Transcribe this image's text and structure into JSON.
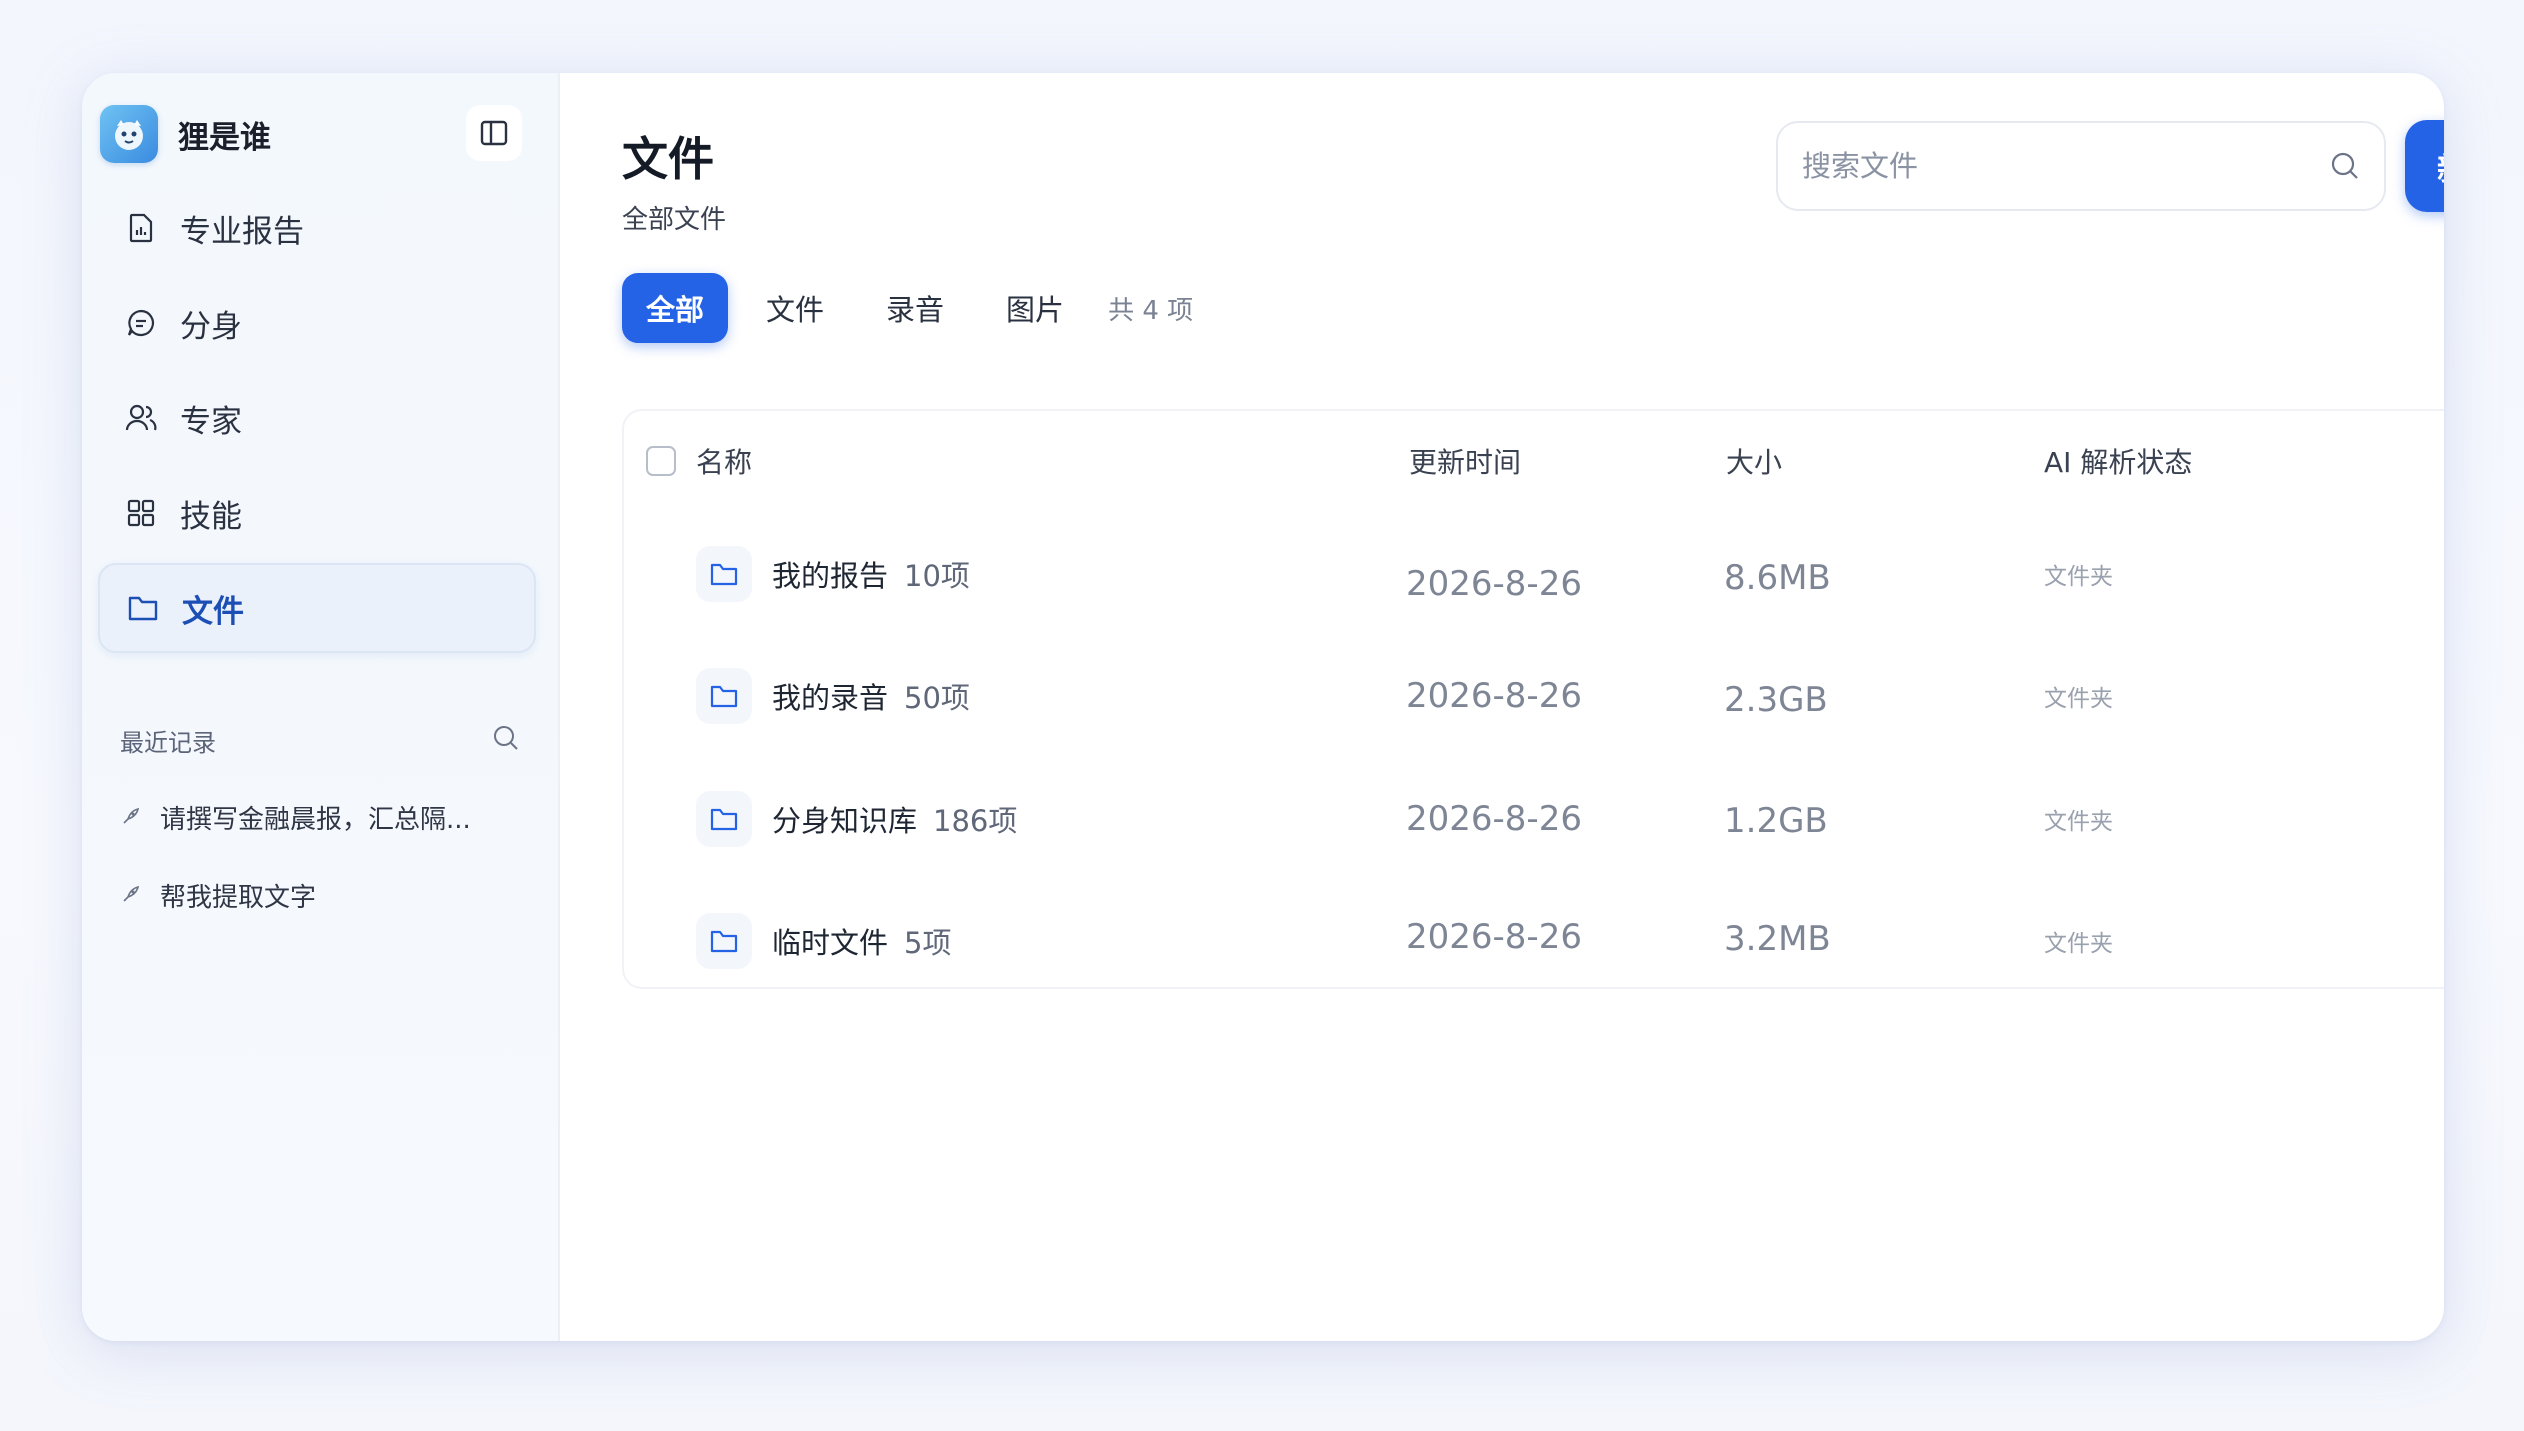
{
  "brand": {
    "name": "狸是谁"
  },
  "nav": {
    "items": [
      {
        "label": "专业报告",
        "icon": "report-icon"
      },
      {
        "label": "分身",
        "icon": "chat-icon"
      },
      {
        "label": "专家",
        "icon": "users-icon"
      },
      {
        "label": "技能",
        "icon": "grid-icon"
      },
      {
        "label": "文件",
        "icon": "folder-icon",
        "active": true
      }
    ]
  },
  "recent": {
    "title": "最近记录",
    "items": [
      {
        "label": "请撰写金融晨报，汇总隔..."
      },
      {
        "label": "帮我提取文字"
      }
    ]
  },
  "header": {
    "title": "文件",
    "subtitle": "全部文件",
    "search_placeholder": "搜索文件",
    "new_button": "新建"
  },
  "tabs": {
    "items": [
      "全部",
      "文件",
      "录音",
      "图片"
    ],
    "active": "全部",
    "count_text": "共 4 项"
  },
  "table": {
    "columns": {
      "name": "名称",
      "time": "更新时间",
      "size": "大小",
      "ai": "AI 解析状态"
    },
    "rows": [
      {
        "name": "我的报告",
        "items": "10项",
        "time": "2026-8-26",
        "size": "8.6MB",
        "ai": "文件夹"
      },
      {
        "name": "我的录音",
        "items": "50项",
        "time": "2026-8-26",
        "size": "2.3GB",
        "ai": "文件夹"
      },
      {
        "name": "分身知识库",
        "items": "186项",
        "time": "2026-8-26",
        "size": "1.2GB",
        "ai": "文件夹"
      },
      {
        "name": "临时文件",
        "items": "5项",
        "time": "2026-8-26",
        "size": "3.2MB",
        "ai": "文件夹"
      }
    ]
  },
  "colors": {
    "accent": "#2563e6",
    "sidebar_bg": "#f3f8fd",
    "active_nav_text": "#1c4fb6"
  }
}
